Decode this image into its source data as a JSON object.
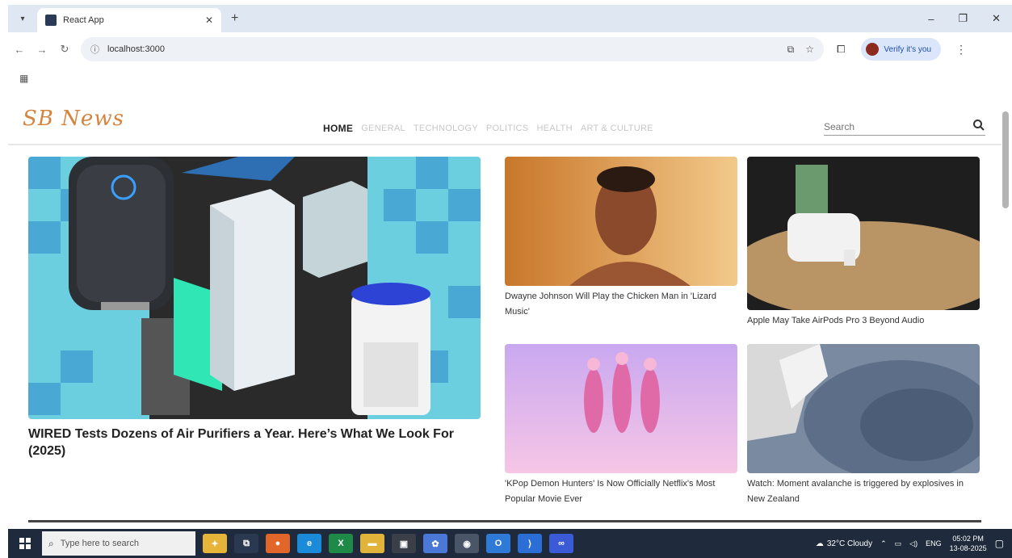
{
  "browser": {
    "tab_title": "React App",
    "url": "localhost:3000",
    "verify_label": "Verify it's you"
  },
  "site": {
    "logo": "SB News",
    "nav": [
      "HOME",
      "GENERAL",
      "TECHNOLOGY",
      "POLITICS",
      "HEALTH",
      "ART & CULTURE"
    ],
    "search_placeholder": "Search"
  },
  "articles": {
    "hero": {
      "title": "WIRED Tests Dozens of Air Purifiers a Year. Here’s What We Look For (2025)"
    },
    "cards": [
      {
        "title": "Dwayne Johnson Will Play the Chicken Man in 'Lizard Music'"
      },
      {
        "title": "Apple May Take AirPods Pro 3 Beyond Audio"
      },
      {
        "title": "'KPop Demon Hunters' Is Now Officially Netflix's Most Popular Movie Ever"
      },
      {
        "title": "Watch: Moment avalanche is triggered by explosives in New Zealand"
      }
    ]
  },
  "taskbar": {
    "search_text": "Type here to search",
    "weather": "32°C Cloudy",
    "language": "ENG",
    "time": "05:02 PM",
    "date": "13-08-2025"
  },
  "colors": {
    "logo": "#d5843f",
    "nav_active": "#222222",
    "nav_inactive": "#c7c7c7",
    "taskbar": "#1f2b3d"
  }
}
